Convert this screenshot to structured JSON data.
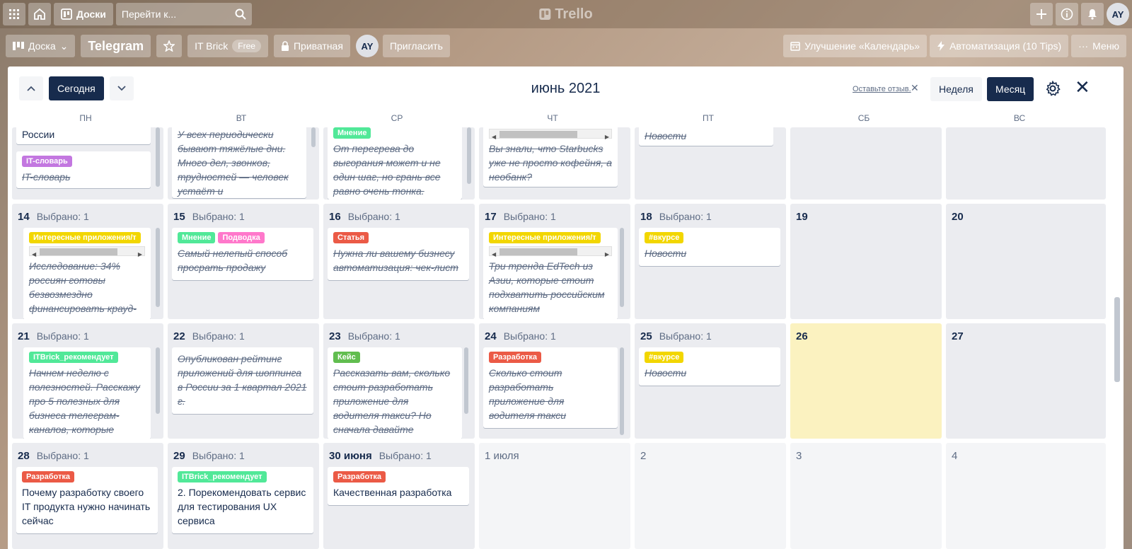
{
  "header": {
    "boards_label": "Доски",
    "search_placeholder": "Перейти к...",
    "logo_text": "Trello",
    "user_initials": "AY"
  },
  "board": {
    "view_label": "Доска",
    "title": "Telegram",
    "workspace": "IT Brick",
    "workspace_badge": "Free",
    "privacy_label": "Приватная",
    "member_initials": "AY",
    "invite_label": "Пригласить",
    "powerup_calendar": "Улучшение «Календарь»",
    "automation_label": "Автоматизация (10 Tips)",
    "menu_label": "Меню"
  },
  "calendar": {
    "today_label": "Сегодня",
    "title": "июнь 2021",
    "feedback_label": "Оставьте отзыв.",
    "week_label": "Неделя",
    "month_label": "Месяц",
    "weekdays": [
      "ПН",
      "ВТ",
      "СР",
      "ЧТ",
      "ПТ",
      "СБ",
      "ВС"
    ],
    "selected_prefix": "Выбрано: 1",
    "top_row": {
      "mon": {
        "title": "России",
        "label": "IT-словарь",
        "title2": "IT-словарь"
      },
      "tue": {
        "title": "У всех периодически бывают тяжёлые дни. Много дел, звонков, трудностей — человек устаёт и"
      },
      "wed": {
        "label": "Мнение",
        "title": "От перегрева до выгорания может и не один шаг, но грань все равно очень тонка."
      },
      "thu": {
        "title": "Вы знали, что Starbucks уже не просто кофейня, а необанк?"
      },
      "fri": {
        "title": "Новости"
      }
    },
    "week3": {
      "d14": {
        "num": "14",
        "label": "Интересные приложения/т",
        "title": "Исследование: 34% россиян готовы безвозмездно финансировать крауд-"
      },
      "d15": {
        "num": "15",
        "label1": "Мнение",
        "label2": "Подводка",
        "title": "Самый нелепый способ просрать продажу"
      },
      "d16": {
        "num": "16",
        "label": "Статья",
        "title": "Нужна ли вашему бизнесу автоматизация: чек-лист"
      },
      "d17": {
        "num": "17",
        "label": "Интересные приложения/т",
        "title": "Три тренда EdTech из Азии, которые стоит подхватить российским компаниям"
      },
      "d18": {
        "num": "18",
        "label": "#вкурсе",
        "title": "Новости"
      },
      "d19": {
        "num": "19"
      },
      "d20": {
        "num": "20"
      }
    },
    "week4": {
      "d21": {
        "num": "21",
        "label": "ITBrick_рекомендует",
        "title": "Начнем неделю с полезностей. Расскажу про 5 полезных для бизнеса телеграм-каналов, которые читаю"
      },
      "d22": {
        "num": "22",
        "title": "Опубликован рейтинг приложений для шоппинга в России за 1 квартал 2021 г."
      },
      "d23": {
        "num": "23",
        "label": "Кейс",
        "title": "Рассказать вам, сколько стоит разработать приложение для водителя такси? Но сначала давайте"
      },
      "d24": {
        "num": "24",
        "label": "Разработка",
        "title": "Сколько стоит разработать приложение для водителя такси"
      },
      "d25": {
        "num": "25",
        "label": "#вкурсе",
        "title": "Новости"
      },
      "d26": {
        "num": "26"
      },
      "d27": {
        "num": "27"
      }
    },
    "week5": {
      "d28": {
        "num": "28",
        "label": "Разработка",
        "title": "Почему разработку своего IT продукта нужно начинать сейчас"
      },
      "d29": {
        "num": "29",
        "label": "ITBrick_рекомендует",
        "title": "2. Порекомендовать сервис для тестирования UX сервиса"
      },
      "d30": {
        "num": "30 июня",
        "label": "Разработка",
        "title": "Качественная разработка"
      },
      "d1": {
        "num": "1 июля"
      },
      "d2": {
        "num": "2"
      },
      "d3": {
        "num": "3"
      },
      "d4": {
        "num": "4"
      }
    },
    "label_colors": {
      "purple": "#c377e0",
      "yellow": "#f2d600",
      "green": "#51e898",
      "pink": "#ff78cb",
      "red": "#eb5a46",
      "darkgreen": "#61bd4f"
    }
  }
}
